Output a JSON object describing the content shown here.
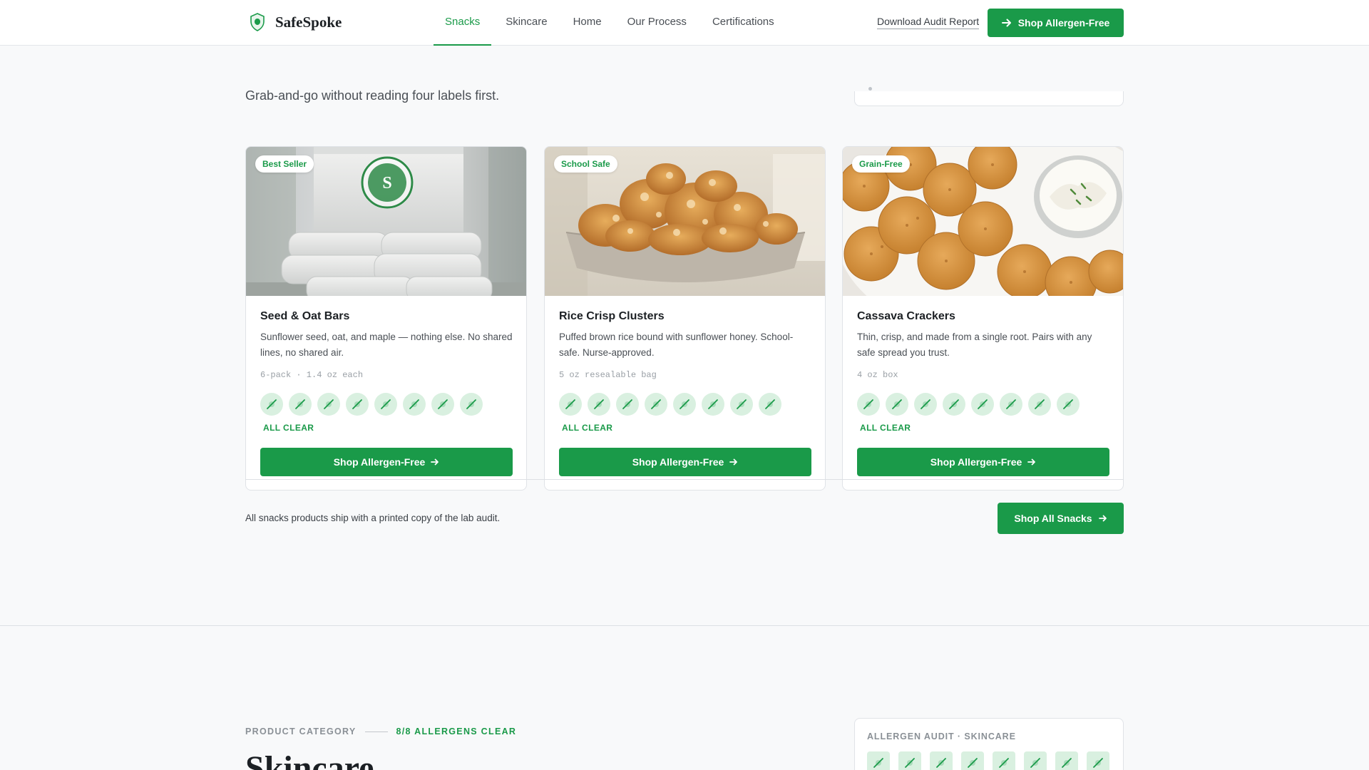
{
  "nav": {
    "brand": "SafeSpoke",
    "links": [
      "Snacks",
      "Skincare",
      "Home",
      "Our Process",
      "Certifications"
    ],
    "active_link": "Snacks",
    "audit_link": "Download Audit Report",
    "cta": "Shop Allergen-Free",
    "cta_icon": "arrow-right-icon"
  },
  "hero": {
    "subtitle": "Grab-and-go without reading four labels first."
  },
  "products": [
    {
      "badge": "Best Seller",
      "title": "Seed & Oat Bars",
      "description": "Sunflower seed, oat, and maple — nothing else. No shared lines, no shared air.",
      "meta": "6-pack · 1.4 oz each",
      "allergens_clear": 8,
      "status": "ALL CLEAR",
      "button": "Shop Allergen-Free",
      "image": "snack-bar-pouches"
    },
    {
      "badge": "School Safe",
      "title": "Rice Crisp Clusters",
      "description": "Puffed brown rice bound with sunflower honey. School-safe. Nurse-approved.",
      "meta": "5 oz resealable bag",
      "allergens_clear": 8,
      "status": "ALL CLEAR",
      "button": "Shop Allergen-Free",
      "image": "rice-cluster-bowl"
    },
    {
      "badge": "Grain-Free",
      "title": "Cassava Crackers",
      "description": "Thin, crisp, and made from a single root. Pairs with any safe spread you trust.",
      "meta": "4 oz box",
      "allergens_clear": 8,
      "status": "ALL CLEAR",
      "button": "Shop Allergen-Free",
      "image": "crackers-with-dip"
    }
  ],
  "footer_note": {
    "text": "All snacks products ship with a printed copy of the lab audit.",
    "button": "Shop All Snacks"
  },
  "skincare": {
    "category_label": "PRODUCT CATEGORY",
    "clear_label": "8/8 ALLERGENS CLEAR",
    "title": "Skincare",
    "audit_label": "ALLERGEN AUDIT · SKINCARE",
    "audit_icon_count": 8
  },
  "colors": {
    "accent": "#1a9a49",
    "accent_light": "#d9f0e0",
    "background": "#f8f9fa"
  }
}
